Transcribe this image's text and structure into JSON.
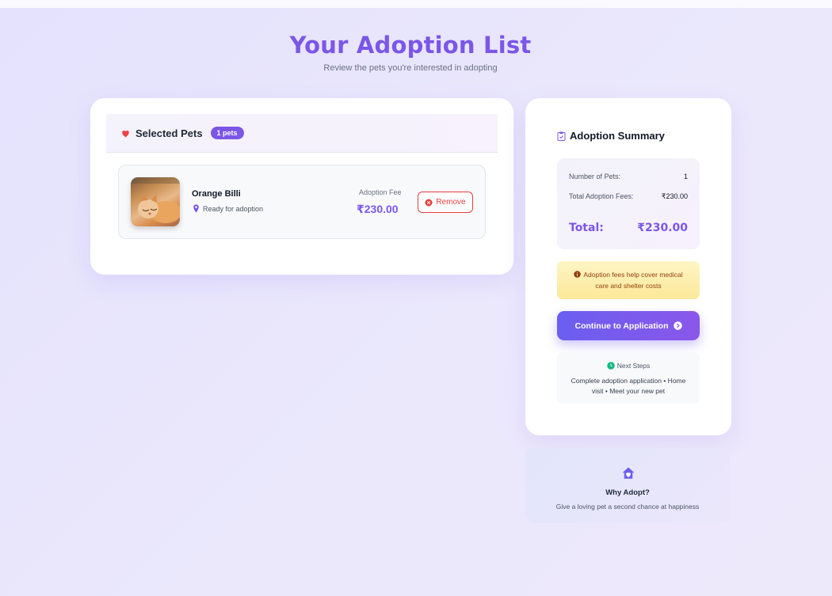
{
  "header": {
    "title": "Your Adoption List",
    "subtitle": "Review the pets you're interested in adopting"
  },
  "selected_pets": {
    "title": "Selected Pets",
    "badge": "1 pets",
    "icon": "heart-icon",
    "items": [
      {
        "name": "Orange Billi",
        "status": "Ready for adoption",
        "fee_label": "Adoption Fee",
        "fee": "₹230.00",
        "remove_label": "Remove",
        "photo": "orange-cat-photo"
      }
    ]
  },
  "summary": {
    "title": "Adoption Summary",
    "icon": "clipboard-icon",
    "rows": [
      {
        "label": "Number of Pets:",
        "value": "1"
      },
      {
        "label": "Total Adoption Fees:",
        "value": "₹230.00"
      }
    ],
    "total_label": "Total:",
    "total_value": "₹230.00",
    "note": "Adoption fees help cover medical care and shelter costs",
    "cta_label": "Continue to Application",
    "next_steps_title": "Next Steps",
    "next_steps_text": "Complete adoption application • Home visit • Meet your new pet"
  },
  "why_adopt": {
    "title": "Why Adopt?",
    "text": "Give a loving pet a second chance at happiness",
    "icon": "home-heart-icon"
  },
  "colors": {
    "accent": "#7b56e8",
    "danger": "#e53e3e",
    "note_text": "#92400e",
    "success": "#10b981"
  }
}
